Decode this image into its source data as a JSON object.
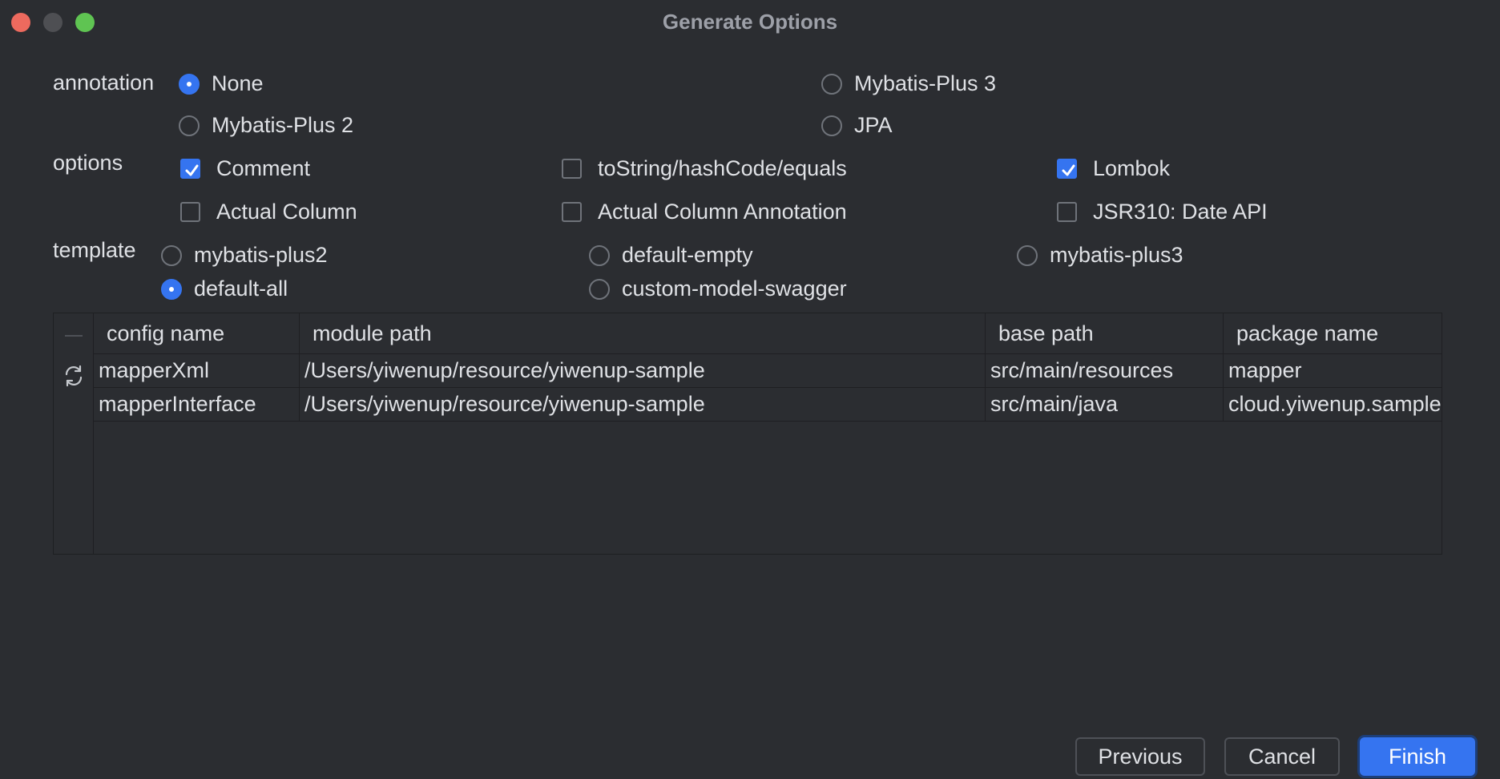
{
  "window": {
    "title": "Generate Options"
  },
  "annotation": {
    "label": "annotation",
    "options": [
      {
        "label": "None",
        "selected": true
      },
      {
        "label": "Mybatis-Plus 3",
        "selected": false
      },
      {
        "label": "Mybatis-Plus 2",
        "selected": false
      },
      {
        "label": "JPA",
        "selected": false
      }
    ]
  },
  "options": {
    "label": "options",
    "items": [
      {
        "label": "Comment",
        "checked": true
      },
      {
        "label": "toString/hashCode/equals",
        "checked": false
      },
      {
        "label": "Lombok",
        "checked": true
      },
      {
        "label": "Actual Column",
        "checked": false
      },
      {
        "label": "Actual Column Annotation",
        "checked": false
      },
      {
        "label": "JSR310: Date API",
        "checked": false
      }
    ]
  },
  "template": {
    "label": "template",
    "options": [
      {
        "label": "mybatis-plus2",
        "selected": false
      },
      {
        "label": "default-empty",
        "selected": false
      },
      {
        "label": "mybatis-plus3",
        "selected": false
      },
      {
        "label": "default-all",
        "selected": true
      },
      {
        "label": "custom-model-swagger",
        "selected": false
      }
    ]
  },
  "table": {
    "columns": [
      "config name",
      "module path",
      "base path",
      "package name"
    ],
    "rows": [
      [
        "mapperXml",
        "/Users/yiwenup/resource/yiwenup-sample",
        "src/main/resources",
        "mapper"
      ],
      [
        "mapperInterface",
        "/Users/yiwenup/resource/yiwenup-sample",
        "src/main/java",
        "cloud.yiwenup.sample"
      ]
    ]
  },
  "buttons": {
    "previous": "Previous",
    "cancel": "Cancel",
    "finish": "Finish"
  },
  "colors": {
    "background": "#2b2d31",
    "accent": "#3574f0",
    "text": "#dfe1e5"
  }
}
